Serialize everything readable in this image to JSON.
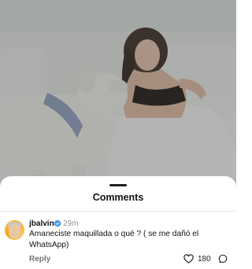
{
  "sheet": {
    "title": "Comments"
  },
  "comment": {
    "username": "jbalvin",
    "verified": true,
    "timestamp": "29m",
    "text": "Amaneciste maquillada o qué ? ( se me dañó el WhatsApp)",
    "reply_label": "Reply",
    "like_count": "180"
  },
  "icons": {
    "verified": "verified-badge-icon",
    "heart": "heart-icon",
    "share": "share-icon"
  },
  "colors": {
    "verified_blue": "#3897f0",
    "sheet_background": "#ffffff",
    "text_primary": "#111111",
    "text_secondary": "#8e8e8e"
  }
}
